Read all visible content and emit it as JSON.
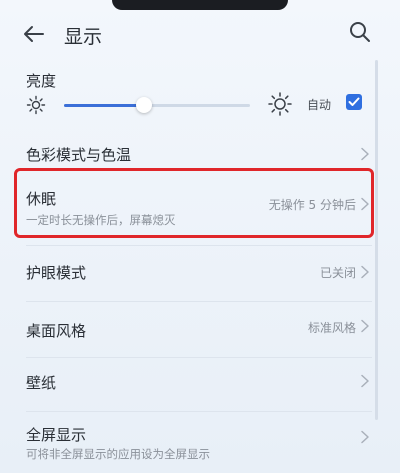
{
  "header": {
    "title": "显示"
  },
  "brightness": {
    "label": "亮度",
    "level": 0.43,
    "auto_label": "自动",
    "auto_checked": true
  },
  "rows": [
    {
      "title": "色彩模式与色温",
      "subtitle": "",
      "value": ""
    },
    {
      "title": "休眠",
      "subtitle": "一定时长无操作后，屏幕熄灭",
      "value": "无操作 5 分钟后"
    },
    {
      "title": "护眼模式",
      "subtitle": "",
      "value": "已关闭"
    },
    {
      "title": "桌面风格",
      "subtitle": "",
      "value": "标准风格"
    },
    {
      "title": "壁纸",
      "subtitle": "",
      "value": ""
    },
    {
      "title": "全屏显示",
      "subtitle": "可将非全屏显示的应用设为全屏显示",
      "value": ""
    }
  ],
  "colors": {
    "accent": "#2f6fe0",
    "highlight_border": "#e0262a",
    "secondary_text": "#8a9099"
  }
}
